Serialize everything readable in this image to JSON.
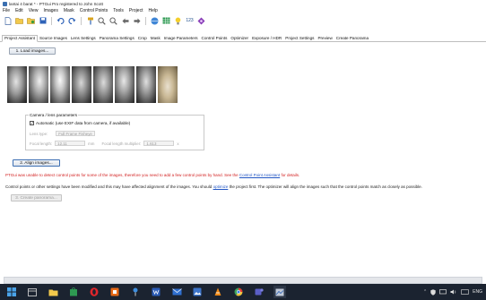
{
  "window": {
    "title": "lantai 4 barat * - PTGui Pro registered to John Scott"
  },
  "menu": [
    "File",
    "Edit",
    "View",
    "Images",
    "Mask",
    "Control Points",
    "Tools",
    "Project",
    "Help"
  ],
  "toolbar": {
    "icons": [
      "new-file-icon",
      "open-folder-icon",
      "open-recent-icon",
      "save-icon",
      "undo-icon",
      "redo-icon",
      "control-point-pin-icon",
      "zoom-in-icon",
      "zoom-out-icon",
      "back-arrow-icon",
      "forward-arrow-icon",
      "panorama-editor-icon",
      "table-icon",
      "lightbulb-icon",
      "numbering-icon",
      "optimizer-icon"
    ],
    "numbering_label": "123"
  },
  "tabs": [
    "Project Assistant",
    "Source Images",
    "Lens Settings",
    "Panorama Settings",
    "Crop",
    "Mask",
    "Image Parameters",
    "Control Points",
    "Optimizer",
    "Exposure / HDR",
    "Project Settings",
    "Preview",
    "Create Panorama"
  ],
  "active_tab": "Project Assistant",
  "step1": {
    "label": "1. Load images..."
  },
  "lens": {
    "title": "Camera / lens parameters",
    "auto_label": "Automatic (use EXIF data from camera, if available)",
    "lens_type_label": "Lens type:",
    "lens_type_value": "Full Frame Fisheye",
    "focal_length_label": "Focal length:",
    "focal_length_value": "12.11",
    "focal_unit": "mm",
    "multiplier_label": "Focal length multiplier:",
    "multiplier_value": "1.613",
    "multiplier_unit": "x"
  },
  "step2": {
    "label": "2. Align images..."
  },
  "messages": {
    "red_text": "PTGui was unable to detect control points for some of the images, therefore you need to add a few control points by hand. See the ",
    "red_link": "Control Point Assistant",
    "red_tail": " for details.",
    "black_text": "Control points or other settings have been modified and this may have affected alignment of the images. You should ",
    "black_link": "optimize",
    "black_tail": " the project first. The optimizer will align the images such that the control points match as closely as possible."
  },
  "step3": {
    "label": "3. Create panorama..."
  },
  "taskbar": {
    "tray_lang": "ENG"
  }
}
